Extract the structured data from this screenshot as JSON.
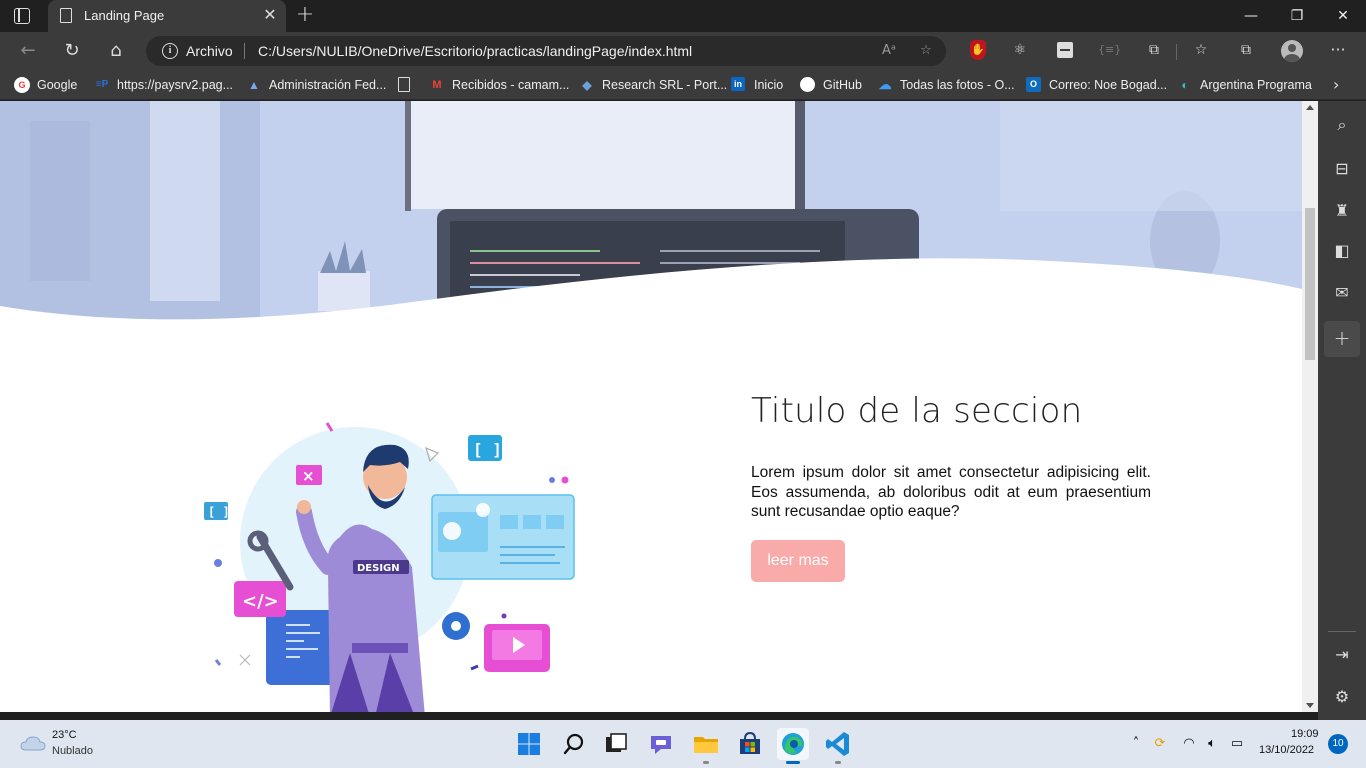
{
  "browser": {
    "tab": {
      "title": "Landing Page",
      "close_icon": "close-icon"
    },
    "window_controls": {
      "minimize": "—",
      "restore": "❐",
      "close": "✕"
    },
    "address": {
      "label": "Archivo",
      "url": "C:/Users/NULIB/OneDrive/Escritorio/practicas/landingPage/index.html"
    },
    "favorites": [
      {
        "label": "Google",
        "icon": "google-icon",
        "color": "#ea4335",
        "glyph": "G"
      },
      {
        "label": "https://paysrv2.pag...",
        "icon": "paysrv-icon",
        "color": "#2a6fdb",
        "glyph": "≡P"
      },
      {
        "label": "Administración Fed...",
        "icon": "afip-icon",
        "color": "#3d7be0",
        "glyph": "▲"
      },
      {
        "label": "",
        "icon": "page-icon",
        "color": "",
        "glyph": ""
      },
      {
        "label": "Recibidos - camam...",
        "icon": "gmail-icon",
        "color": "#d93025",
        "glyph": "M"
      },
      {
        "label": "Research SRL - Port...",
        "icon": "research-icon",
        "color": "#2f6fb0",
        "glyph": "◆"
      },
      {
        "label": "Inicio",
        "icon": "linkedin-icon",
        "color": "#0a66c2",
        "glyph": "in"
      },
      {
        "label": "GitHub",
        "icon": "github-icon",
        "color": "#ffffff",
        "glyph": "●"
      },
      {
        "label": "Todas las fotos - O...",
        "icon": "onedrive-icon",
        "color": "#0f7ad8",
        "glyph": "☁"
      },
      {
        "label": "Correo: Noe Bogad...",
        "icon": "outlook-icon",
        "color": "#0f6cbd",
        "glyph": "O"
      },
      {
        "label": "Argentina Programa",
        "icon": "argprog-icon",
        "color": "#3fb8c9",
        "glyph": "◐"
      }
    ]
  },
  "page": {
    "section_title": "Titulo de la seccion",
    "section_text": "Lorem ipsum dolor sit amet consectetur adipisicing elit. Eos assumenda, ab doloribus odit at eum praesentium sunt recusandae optio eaque?",
    "button_label": "leer mas",
    "illustration_badge": "DESIGN"
  },
  "taskbar": {
    "weather_temp": "23°C",
    "weather_desc": "Nublado",
    "time": "19:09",
    "date": "13/10/2022",
    "notifications": "10"
  },
  "colors": {
    "button": "#f8aba8",
    "hero_overlay": "#c6d3ee",
    "accent": "#0067c0"
  }
}
